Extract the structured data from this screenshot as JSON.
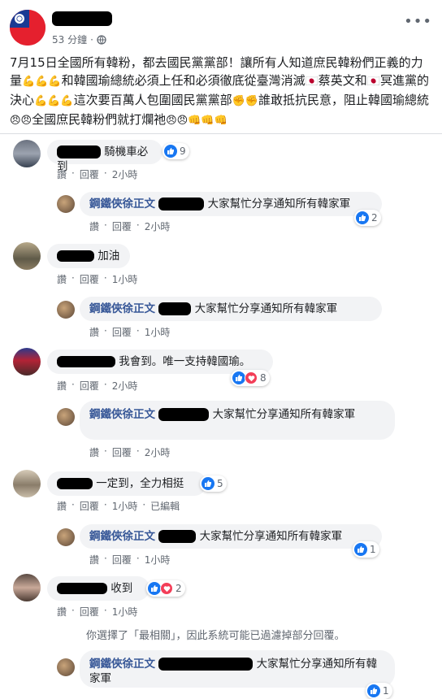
{
  "post": {
    "time": "53 分鐘",
    "text_parts": [
      "7月15日全國所有韓粉，都去國民黨黨部！讓所有人知道庶民韓粉們正義的力量",
      "💪💪💪",
      "和韓國瑜總統必須上任和必須徹底從臺灣消滅",
      "🇯🇵",
      "蔡英文和",
      "🇯🇵",
      "冥進黨的決心",
      "💪💪💪",
      "這次要百萬人包圍國民黨黨部",
      "✊✊",
      "誰敢抵抗民意，阻止韓國瑜總統",
      "😠😠",
      "全國庶民韓粉們就打爛祂",
      "😠😠👊👊👊"
    ]
  },
  "actions": {
    "like": "讚",
    "reply": "回覆",
    "edited": "已編輯"
  },
  "replier_name": "鋼鐵俠徐正文",
  "reply_text": "大家幫忙分享通知所有韓家軍",
  "comments": [
    {
      "text": "騎機車必到",
      "time": "2小時",
      "reacts": "9",
      "reply": {
        "time": "2小時",
        "reacts": "2"
      }
    },
    {
      "text": "加油",
      "time": "1小時",
      "reply": {
        "time": "1小時"
      }
    },
    {
      "text": "我會到。唯一支持韓國瑜。",
      "time": "2小時",
      "reacts": "8",
      "reply": {
        "time": "2小時"
      }
    },
    {
      "text": "一定到，全力相挺",
      "time": "1小時",
      "reacts": "5",
      "reply": {
        "time": "1小時",
        "reacts": "1"
      }
    },
    {
      "text": "收到",
      "time": "1小時",
      "reacts": "2",
      "reply": {
        "reacts": "1"
      }
    }
  ],
  "filter_note": "你選擇了「最相關」，因此系統可能已過濾掉部分回覆。",
  "colors": {
    "name_link": "#385898",
    "bubble": "#f2f3f5",
    "meta": "#606770",
    "like": "#1877f2",
    "love": "#f33e58"
  }
}
